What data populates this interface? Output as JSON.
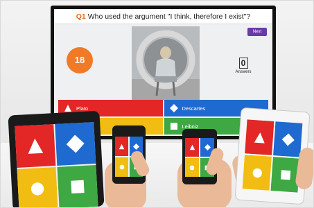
{
  "tv": {
    "question_number": "Q1",
    "question_text": "Who used the argument \"I think, therefore I exist\"?",
    "next_label": "Next",
    "timer": "18",
    "answers_count": "0",
    "answers_label": "Answers",
    "options": [
      "Plato",
      "Descartes",
      "",
      "Leibniz"
    ]
  },
  "colors": {
    "red": "#e32727",
    "blue": "#1f6ad1",
    "yellow": "#f2bd12",
    "green": "#3ea843",
    "timer": "#f07a28",
    "next": "#6a3aa7"
  },
  "icons": [
    "triangle-icon",
    "diamond-icon",
    "circle-icon",
    "square-icon"
  ]
}
